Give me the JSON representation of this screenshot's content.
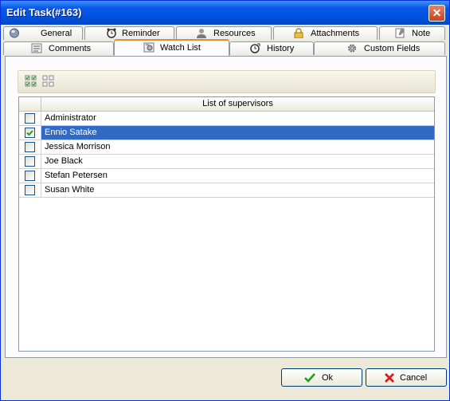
{
  "window": {
    "title": "Edit Task(#163)"
  },
  "tabs_top": [
    {
      "label": "General",
      "icon": "globe-icon"
    },
    {
      "label": "Reminder",
      "icon": "alarm-clock-icon"
    },
    {
      "label": "Resources",
      "icon": "user-icon"
    },
    {
      "label": "Attachments",
      "icon": "padlock-icon"
    },
    {
      "label": "Note",
      "icon": "note-icon"
    }
  ],
  "tabs_bottom": [
    {
      "label": "Comments",
      "icon": "comments-icon"
    },
    {
      "label": "Watch List",
      "icon": "watch-list-icon",
      "active": true
    },
    {
      "label": "History",
      "icon": "history-icon"
    },
    {
      "label": "Custom Fields",
      "icon": "gear-icon"
    }
  ],
  "toolbar": {
    "buttons": [
      "select-all-icon",
      "deselect-all-icon"
    ]
  },
  "grid": {
    "header": "List of supervisors",
    "rows": [
      {
        "name": "Administrator",
        "checked": false,
        "selected": false
      },
      {
        "name": "Ennio Satake",
        "checked": true,
        "selected": true
      },
      {
        "name": "Jessica Morrison",
        "checked": false,
        "selected": false
      },
      {
        "name": "Joe Black",
        "checked": false,
        "selected": false
      },
      {
        "name": "Stefan Petersen",
        "checked": false,
        "selected": false
      },
      {
        "name": "Susan White",
        "checked": false,
        "selected": false
      }
    ]
  },
  "buttons": {
    "ok": "Ok",
    "cancel": "Cancel"
  },
  "colors": {
    "title_bar": "#0054e3",
    "selection": "#316ac5",
    "dialog_bg": "#ece9d8",
    "active_tab_accent": "#e68b2c"
  }
}
